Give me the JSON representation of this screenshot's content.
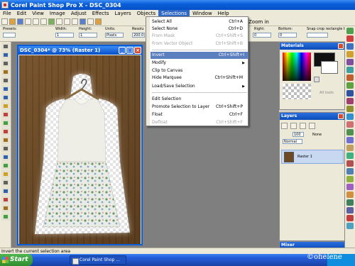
{
  "app": {
    "title": "Corel Paint Shop Pro X - DSC_0304"
  },
  "menubar": [
    "File",
    "Edit",
    "View",
    "Image",
    "Adjust",
    "Effects",
    "Layers",
    "Objects",
    "Selections",
    "Window",
    "Help"
  ],
  "toolbar": {
    "zoom_label": "Zoom in"
  },
  "options": {
    "presets_label": "Presets:",
    "width_label": "Width:",
    "width_value": "1",
    "height_label": "Height:",
    "height_value": "1",
    "units_label": "Units:",
    "units_value": "Pixels",
    "resolution_label": "Resolu",
    "resolution_value": "200.0",
    "right_label": "Right:",
    "right_value": "0",
    "bottom_label": "Bottom:",
    "bottom_value": "0",
    "snap_label": "Snap crop rectangle to:"
  },
  "image_window": {
    "title": "DSC_0304* @  73% (Raster 1)"
  },
  "selections_menu": [
    {
      "label": "Select All",
      "shortcut": "Ctrl+A",
      "state": "normal"
    },
    {
      "label": "Select None",
      "shortcut": "Ctrl+D",
      "state": "normal"
    },
    {
      "label": "From Mask",
      "shortcut": "Ctrl+Shift+S",
      "state": "disabled"
    },
    {
      "label": "From Vector Object",
      "shortcut": "Ctrl+Shift+B",
      "state": "disabled"
    },
    {
      "label": "Invert",
      "shortcut": "Ctrl+Shift+I",
      "state": "highlighted"
    },
    {
      "label": "Modify",
      "shortcut": "",
      "state": "submenu"
    },
    {
      "label": "Clip to Canvas",
      "shortcut": "",
      "state": "normal"
    },
    {
      "label": "Hide Marquee",
      "shortcut": "Ctrl+Shift+M",
      "state": "normal"
    },
    {
      "label": "Load/Save Selection",
      "shortcut": "",
      "state": "submenu"
    },
    {
      "label": "Edit Selection",
      "shortcut": "",
      "state": "normal"
    },
    {
      "label": "Promote Selection to Layer",
      "shortcut": "Ctrl+Shift+P",
      "state": "normal"
    },
    {
      "label": "Float",
      "shortcut": "Ctrl+F",
      "state": "normal"
    },
    {
      "label": "Defloat",
      "shortcut": "Ctrl+Shift+F",
      "state": "disabled"
    }
  ],
  "materials_panel": {
    "title": "Materials",
    "all_tools": "All tools"
  },
  "layers_panel": {
    "title": "Layers",
    "opacity": "100",
    "mode": "Normal",
    "layer_name": "Raster 1",
    "none_label": "None"
  },
  "mixer_panel": {
    "title": "Mixer"
  },
  "status": {
    "text": "Invert the current selection area"
  },
  "taskbar": {
    "start": "Start",
    "task_item": "Corel Paint Shop ..."
  },
  "watermark": "©ohelene",
  "colors": {
    "menu_highlight": "#5b7fbf",
    "title_blue": "#0a5fd8"
  }
}
